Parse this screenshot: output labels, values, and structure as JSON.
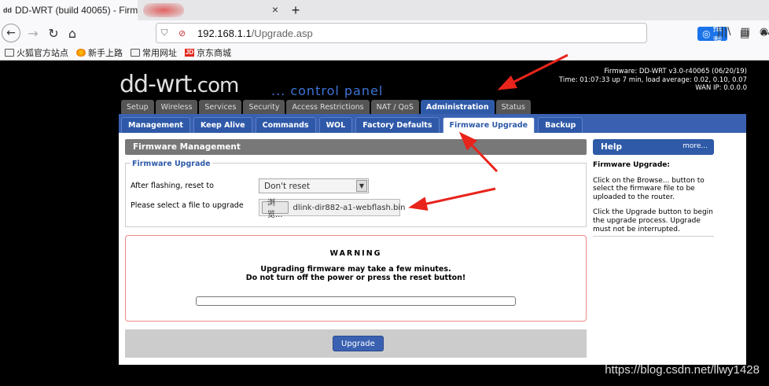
{
  "browser": {
    "tab_title": "DD-WRT (build 40065) - Firm",
    "favicon_text": "dd",
    "tab_close": "×",
    "new_tab": "+",
    "url_host": "192.168.1.1",
    "url_path": "/Upgrade.asp",
    "reco_label": "推荐",
    "bookmarks": [
      "火狐官方站点",
      "新手上路",
      "常用网址",
      "京东商城"
    ],
    "jd_badge": "JD"
  },
  "router": {
    "logo_text": "dd-wrt",
    "logo_suffix": ".com",
    "subtitle": "... control panel",
    "firmware": "Firmware: DD-WRT v3.0-r40065 (06/20/19)",
    "uptime": "Time: 01:07:33 up 7 min, load average: 0.02, 0.10, 0.07",
    "wan_ip": "WAN IP: 0.0.0.0"
  },
  "main_tabs": [
    "Setup",
    "Wireless",
    "Services",
    "Security",
    "Access Restrictions",
    "NAT / QoS",
    "Administration",
    "Status"
  ],
  "sub_tabs": [
    "Management",
    "Keep Alive",
    "Commands",
    "WOL",
    "Factory Defaults",
    "Firmware Upgrade",
    "Backup"
  ],
  "section": {
    "header": "Firmware Management",
    "legend": "Firmware Upgrade",
    "reset_label": "After flashing, reset to",
    "reset_value": "Don't reset",
    "file_label": "Please select a file to upgrade",
    "browse_label": "浏览...",
    "file_name": "dlink-dir882-a1-webflash.bin"
  },
  "warning": {
    "title": "WARNING",
    "line1": "Upgrading firmware may take a few minutes.",
    "line2": "Do not turn off the power or press the reset button!",
    "progress": 0
  },
  "actions": {
    "upgrade_label": "Upgrade"
  },
  "help": {
    "header": "Help",
    "more": "more...",
    "title": "Firmware Upgrade:",
    "p1": "Click on the Browse... button to select the firmware file to be uploaded to the router.",
    "p2": "Click the Upgrade button to begin the upgrade process. Upgrade must not be interrupted."
  },
  "watermark": "https://blog.csdn.net/llwy1428"
}
